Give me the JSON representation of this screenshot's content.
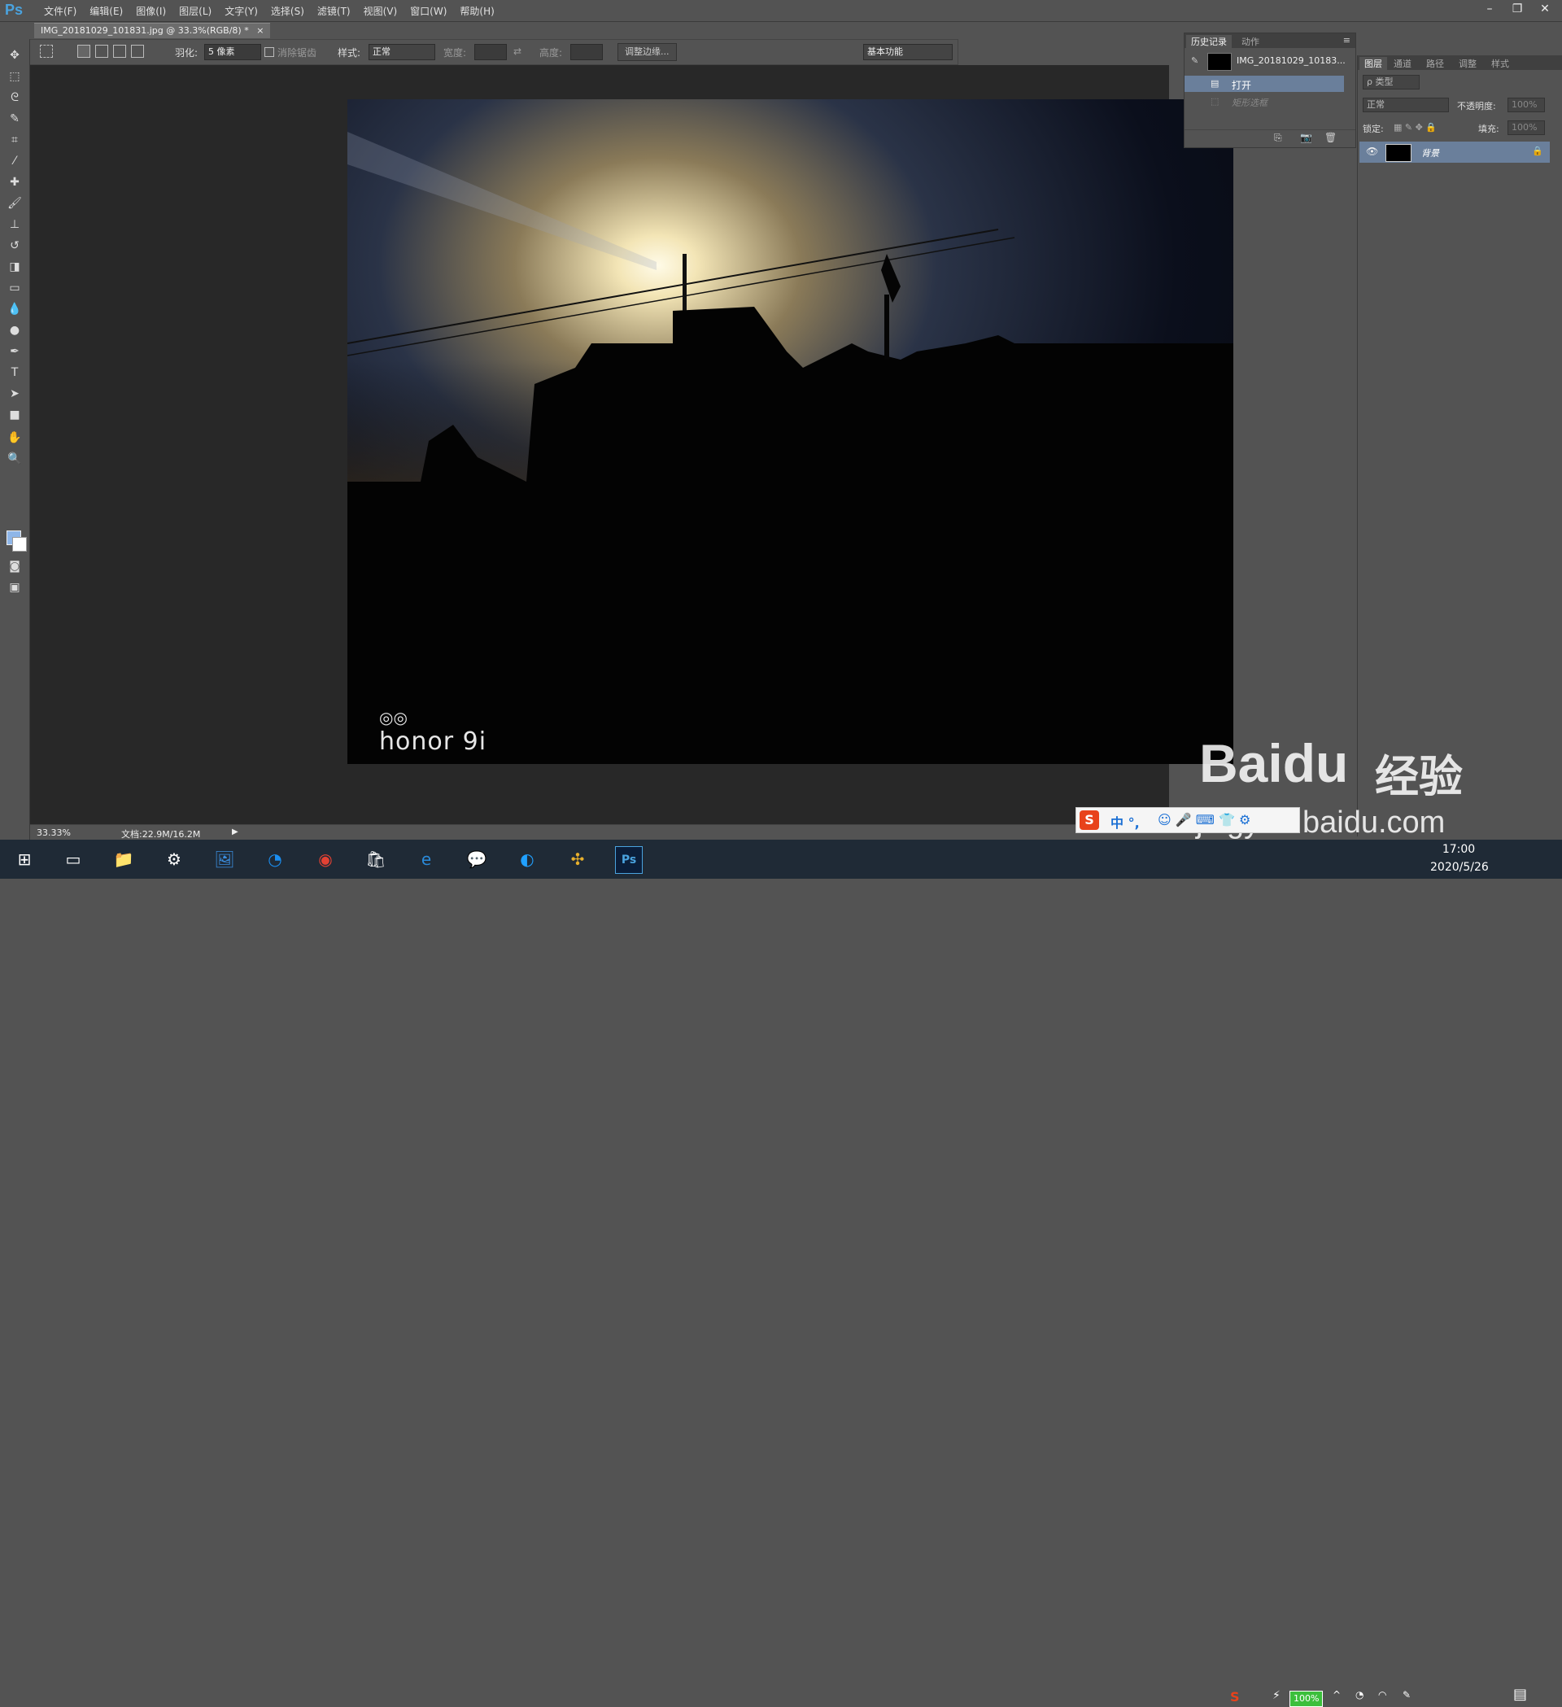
{
  "app": {
    "logo": "Ps",
    "menu": [
      "文件(F)",
      "编辑(E)",
      "图像(I)",
      "图层(L)",
      "文字(Y)",
      "选择(S)",
      "滤镜(T)",
      "视图(V)",
      "窗口(W)",
      "帮助(H)"
    ],
    "window_controls": [
      "–",
      "❐",
      "✕"
    ]
  },
  "document": {
    "tab_title": "IMG_20181029_101831.jpg @ 33.3%(RGB/8) *",
    "tab_close": "×",
    "watermark_brand": "honor 9i"
  },
  "options_bar": {
    "feather_label": "羽化:",
    "feather_value": "5 像素",
    "antialias_label": "消除锯齿",
    "style_label": "样式:",
    "style_value": "正常",
    "width_label": "宽度:",
    "height_label": "高度:",
    "refine_edge_button": "调整边缘...",
    "workspace_value": "基本功能"
  },
  "history_panel": {
    "tabs": [
      "历史记录",
      "动作"
    ],
    "snapshot_name": "IMG_20181029_10183...",
    "steps": [
      "打开",
      "矩形选框"
    ]
  },
  "layers_panel": {
    "tabs": [
      "图层",
      "通道",
      "路径",
      "调整",
      "样式"
    ],
    "filter_label": "ρ 类型",
    "blend_mode": "正常",
    "opacity_label": "不透明度:",
    "opacity_value": "100%",
    "lock_label": "锁定:",
    "fill_label": "填充:",
    "fill_value": "100%",
    "layers": [
      {
        "name": "背景"
      }
    ]
  },
  "status_bar": {
    "zoom": "33.33%",
    "doc_size": "文档:22.9M/16.2M"
  },
  "ime": {
    "logo": "S",
    "mode": "中 °,"
  },
  "watermark": {
    "baidu": "Baidu",
    "jingyan": "经验",
    "url": "jingyan.baidu.com"
  },
  "taskbar": {
    "battery": "100%",
    "time": "17:00",
    "date": "2020/5/26"
  },
  "colors": {
    "selection_blue": "#6a7f9b",
    "foreground": "#8fb6e8",
    "background": "#ffffff"
  }
}
